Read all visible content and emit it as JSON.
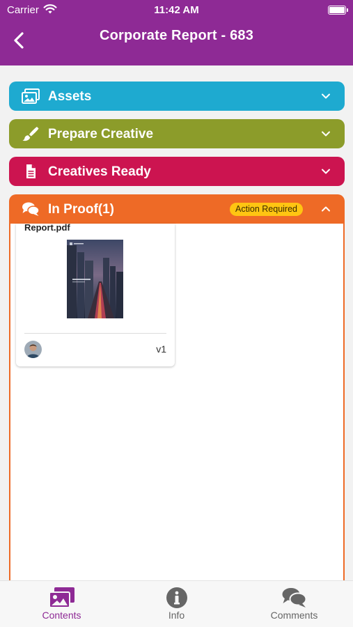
{
  "status_bar": {
    "carrier": "Carrier",
    "time": "11:42 AM"
  },
  "header": {
    "title": "Corporate Report - 683"
  },
  "sections": [
    {
      "label": "Assets",
      "icon": "images-icon",
      "color": "#1eaad0"
    },
    {
      "label": "Prepare Creative",
      "icon": "paintbrush-icon",
      "color": "#8c9c2a"
    },
    {
      "label": "Creatives Ready",
      "icon": "document-icon",
      "color": "#cc1450"
    },
    {
      "label": "In Proof(1)",
      "icon": "comments-icon",
      "color": "#ee6a26",
      "badge": "Action Required",
      "badge_color": "#ffc512",
      "expanded": true
    }
  ],
  "proof_files": [
    {
      "filename": "Report.pdf",
      "version": "v1"
    }
  ],
  "tabs": [
    {
      "label": "Contents",
      "icon": "images-icon",
      "active": true,
      "color": "#8e2a95"
    },
    {
      "label": "Info",
      "icon": "info-circle-icon",
      "active": false,
      "color": "#666666"
    },
    {
      "label": "Comments",
      "icon": "comments-icon",
      "active": false,
      "color": "#666666"
    }
  ]
}
